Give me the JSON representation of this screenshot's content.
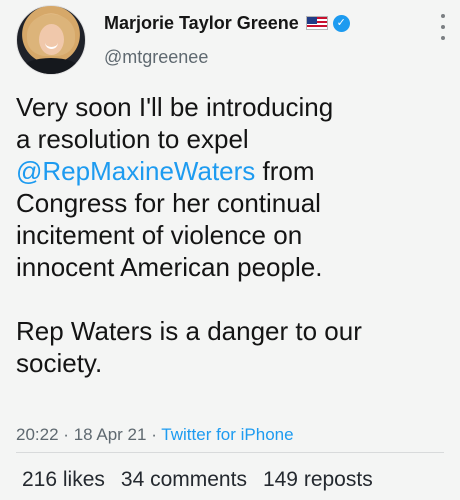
{
  "author": {
    "name": "Marjorie Taylor Greene",
    "handle": "@mtgreenee",
    "avatar_icon": "profile-photo",
    "flag_icon": "us-flag-icon",
    "verified_icon": "verified-badge-icon"
  },
  "tweet": {
    "lines": [
      {
        "text": "Very soon I'll be introducing",
        "mention": null
      },
      {
        "text": "a resolution to expel",
        "mention": null
      },
      {
        "text": " from",
        "mention": "@RepMaxineWaters"
      },
      {
        "text": "Congress for her continual",
        "mention": null
      },
      {
        "text": "incitement of violence on",
        "mention": null
      },
      {
        "text": "innocent American people.",
        "mention": null
      },
      {
        "text": "Rep Waters is a danger to our",
        "mention": null
      },
      {
        "text": "society.",
        "mention": null
      }
    ]
  },
  "meta": {
    "time": "20:22",
    "date": "18 Apr 21",
    "separator": "·",
    "source": "Twitter for iPhone"
  },
  "stats": {
    "likes": "216 likes",
    "comments": "34 comments",
    "reposts": "149 reposts"
  },
  "colors": {
    "link": "#1d9bf0",
    "text": "#141414",
    "muted": "#5f6970",
    "background": "#f4f5f4"
  }
}
